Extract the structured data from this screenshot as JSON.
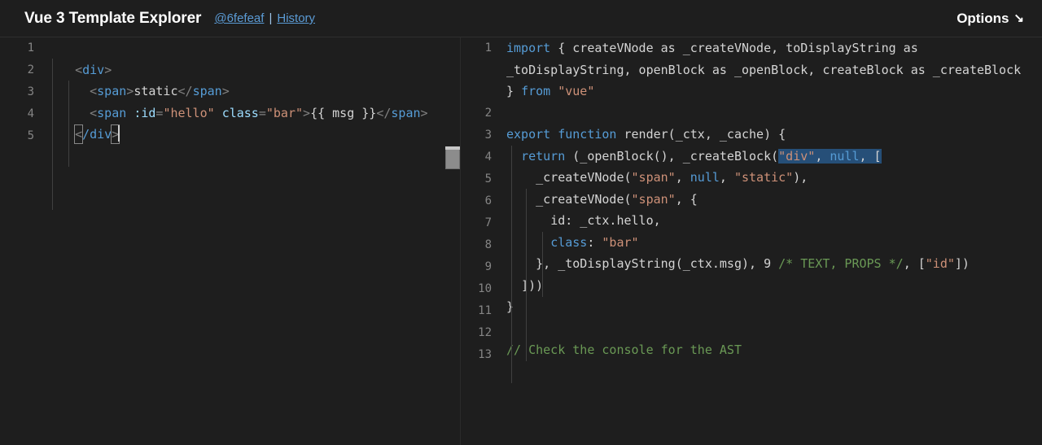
{
  "header": {
    "title": "Vue 3 Template Explorer",
    "commit_link": "@6fefeaf",
    "separator": "|",
    "history_link": "History",
    "options_label": "Options",
    "options_arrow": "↘"
  },
  "left_editor": {
    "name": "template-source-editor",
    "line_numbers": [
      "1",
      "2",
      "3",
      "4",
      "5"
    ],
    "lines": [
      {
        "n": "1",
        "tokens": []
      },
      {
        "n": "2",
        "tokens": [
          {
            "text": "  ",
            "cls": "t-plain"
          },
          {
            "text": "<",
            "cls": "t-punct"
          },
          {
            "text": "div",
            "cls": "t-tag"
          },
          {
            "text": ">",
            "cls": "t-punct"
          }
        ]
      },
      {
        "n": "3",
        "tokens": [
          {
            "text": "    ",
            "cls": "t-plain"
          },
          {
            "text": "<",
            "cls": "t-punct"
          },
          {
            "text": "span",
            "cls": "t-tag"
          },
          {
            "text": ">",
            "cls": "t-punct"
          },
          {
            "text": "static",
            "cls": "t-plain"
          },
          {
            "text": "</",
            "cls": "t-punct"
          },
          {
            "text": "span",
            "cls": "t-tag"
          },
          {
            "text": ">",
            "cls": "t-punct"
          }
        ]
      },
      {
        "n": "4",
        "tokens": [
          {
            "text": "    ",
            "cls": "t-plain"
          },
          {
            "text": "<",
            "cls": "t-punct"
          },
          {
            "text": "span",
            "cls": "t-tag"
          },
          {
            "text": " ",
            "cls": "t-plain"
          },
          {
            "text": ":id",
            "cls": "t-attr"
          },
          {
            "text": "=",
            "cls": "t-punct"
          },
          {
            "text": "\"hello\"",
            "cls": "t-string"
          },
          {
            "text": " ",
            "cls": "t-plain"
          },
          {
            "text": "class",
            "cls": "t-attr"
          },
          {
            "text": "=",
            "cls": "t-punct"
          },
          {
            "text": "\"bar\"",
            "cls": "t-string"
          },
          {
            "text": ">",
            "cls": "t-punct"
          },
          {
            "text": "{{ msg }}",
            "cls": "t-plain"
          },
          {
            "text": "</",
            "cls": "t-punct"
          },
          {
            "text": "span",
            "cls": "t-tag"
          },
          {
            "text": ">",
            "cls": "t-punct"
          }
        ]
      },
      {
        "n": "5",
        "tokens": [
          {
            "text": "  ",
            "cls": "t-plain"
          },
          {
            "text": "<",
            "cls": "t-punct",
            "bracket": true
          },
          {
            "text": "/div",
            "cls": "t-tag"
          },
          {
            "text": ">",
            "cls": "t-punct",
            "bracket": true
          }
        ]
      }
    ],
    "raw_text": "\n  <div>\n    <span>static</span>\n    <span :id=\"hello\" class=\"bar\">{{ msg }}</span>\n  </div>"
  },
  "right_editor": {
    "name": "compiled-output-viewer",
    "line_numbers": [
      "1",
      "2",
      "3",
      "4",
      "5",
      "6",
      "7",
      "8",
      "9",
      "10",
      "11",
      "12",
      "13"
    ],
    "lines": [
      {
        "n": "1",
        "tokens": [
          {
            "text": "import",
            "cls": "t-keyword"
          },
          {
            "text": " { createVNode as _createVNode, toDisplayString as _toDisplayString, openBlock as _openBlock, createBlock as _createBlock } ",
            "cls": "t-plain"
          },
          {
            "text": "from",
            "cls": "t-keyword"
          },
          {
            "text": " ",
            "cls": "t-plain"
          },
          {
            "text": "\"vue\"",
            "cls": "t-string"
          }
        ]
      },
      {
        "n": "2",
        "tokens": []
      },
      {
        "n": "3",
        "tokens": [
          {
            "text": "export function",
            "cls": "t-keyword"
          },
          {
            "text": " render(_ctx, _cache) {",
            "cls": "t-plain"
          }
        ]
      },
      {
        "n": "4",
        "tokens": [
          {
            "text": "  ",
            "cls": "t-plain"
          },
          {
            "text": "return",
            "cls": "t-keyword"
          },
          {
            "text": " (_openBlock(), _createBlock(",
            "cls": "t-plain"
          },
          {
            "text": "\"div\"",
            "cls": "t-string",
            "sel": true
          },
          {
            "text": ", ",
            "cls": "t-plain",
            "sel": true
          },
          {
            "text": "null",
            "cls": "t-keyword",
            "sel": true
          },
          {
            "text": ", [",
            "cls": "t-plain",
            "sel": true
          }
        ]
      },
      {
        "n": "5",
        "tokens": [
          {
            "text": "    _createVNode(",
            "cls": "t-plain"
          },
          {
            "text": "\"span\"",
            "cls": "t-string"
          },
          {
            "text": ", ",
            "cls": "t-plain"
          },
          {
            "text": "null",
            "cls": "t-keyword"
          },
          {
            "text": ", ",
            "cls": "t-plain"
          },
          {
            "text": "\"static\"",
            "cls": "t-string"
          },
          {
            "text": "),",
            "cls": "t-plain"
          }
        ]
      },
      {
        "n": "6",
        "tokens": [
          {
            "text": "    _createVNode(",
            "cls": "t-plain"
          },
          {
            "text": "\"span\"",
            "cls": "t-string"
          },
          {
            "text": ", {",
            "cls": "t-plain"
          }
        ]
      },
      {
        "n": "7",
        "tokens": [
          {
            "text": "      id: _ctx.hello,",
            "cls": "t-plain"
          }
        ]
      },
      {
        "n": "8",
        "tokens": [
          {
            "text": "      ",
            "cls": "t-plain"
          },
          {
            "text": "class",
            "cls": "t-keyword"
          },
          {
            "text": ": ",
            "cls": "t-plain"
          },
          {
            "text": "\"bar\"",
            "cls": "t-string"
          }
        ]
      },
      {
        "n": "9",
        "tokens": [
          {
            "text": "    }, _toDisplayString(_ctx.msg), ",
            "cls": "t-plain"
          },
          {
            "text": "9",
            "cls": "t-number"
          },
          {
            "text": " ",
            "cls": "t-plain"
          },
          {
            "text": "/* TEXT, PROPS */",
            "cls": "t-comment"
          },
          {
            "text": ", [",
            "cls": "t-plain"
          },
          {
            "text": "\"id\"",
            "cls": "t-string"
          },
          {
            "text": "])",
            "cls": "t-plain"
          }
        ]
      },
      {
        "n": "10",
        "tokens": [
          {
            "text": "  ]))",
            "cls": "t-plain"
          }
        ]
      },
      {
        "n": "11",
        "tokens": [
          {
            "text": "}",
            "cls": "t-plain"
          }
        ]
      },
      {
        "n": "12",
        "tokens": []
      },
      {
        "n": "13",
        "tokens": [
          {
            "text": "// Check the console for the AST",
            "cls": "t-comment"
          }
        ]
      }
    ],
    "comment_line": "// Check the console for the AST"
  },
  "colors": {
    "background": "#1e1e1e",
    "header_bg": "#1e1e1e",
    "link": "#5b9bd5",
    "line_number": "#858585",
    "text": "#d4d4d4",
    "keyword": "#569cd6",
    "string": "#ce9178",
    "comment": "#6a9955",
    "attribute": "#9cdcfe",
    "punctuation": "#808080",
    "selection": "#264f78"
  }
}
